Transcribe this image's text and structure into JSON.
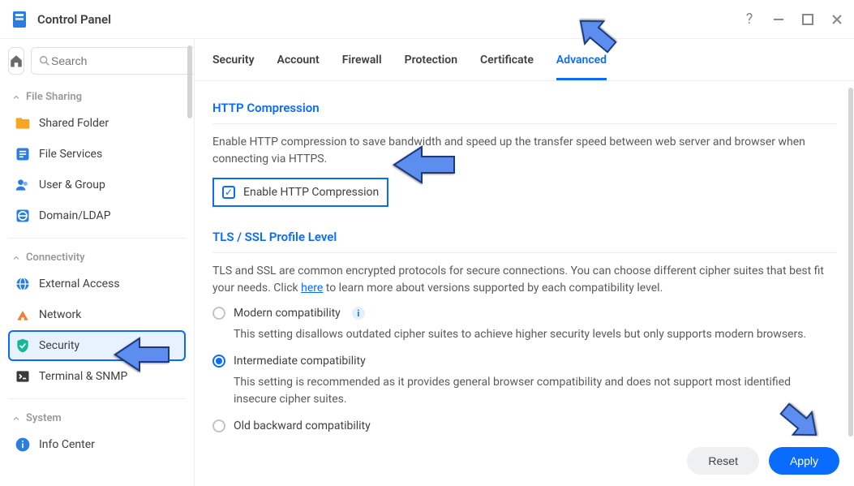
{
  "window": {
    "title": "Control Panel"
  },
  "search": {
    "placeholder": "Search"
  },
  "sidebar": {
    "sections": [
      {
        "label": "File Sharing",
        "items": [
          {
            "label": "Shared Folder",
            "icon": "folder"
          },
          {
            "label": "File Services",
            "icon": "fileservices"
          },
          {
            "label": "User & Group",
            "icon": "usergroup"
          },
          {
            "label": "Domain/LDAP",
            "icon": "domain"
          }
        ]
      },
      {
        "label": "Connectivity",
        "items": [
          {
            "label": "External Access",
            "icon": "globe"
          },
          {
            "label": "Network",
            "icon": "network"
          },
          {
            "label": "Security",
            "icon": "security",
            "active": true
          },
          {
            "label": "Terminal & SNMP",
            "icon": "terminal"
          }
        ]
      },
      {
        "label": "System",
        "items": [
          {
            "label": "Info Center",
            "icon": "info"
          }
        ]
      }
    ]
  },
  "tabs": [
    {
      "label": "Security"
    },
    {
      "label": "Account"
    },
    {
      "label": "Firewall"
    },
    {
      "label": "Protection"
    },
    {
      "label": "Certificate"
    },
    {
      "label": "Advanced",
      "active": true
    }
  ],
  "http_compression": {
    "title": "HTTP Compression",
    "desc": "Enable HTTP compression to save bandwidth and speed up the transfer speed between web server and browser when connecting via HTTPS.",
    "checkbox_label": "Enable HTTP Compression",
    "checked": true
  },
  "tls": {
    "title": "TLS / SSL Profile Level",
    "desc_pre": "TLS and SSL are common encrypted protocols for secure connections. You can choose different cipher suites that best fit your needs. Click ",
    "desc_link": "here",
    "desc_post": " to learn more about versions supported by each compatibility level.",
    "options": [
      {
        "label": "Modern compatibility",
        "desc": "This setting disallows outdated cipher suites to achieve higher security levels but only supports modern browsers.",
        "info": true
      },
      {
        "label": "Intermediate compatibility",
        "desc": "This setting is recommended as it provides general browser compatibility and does not support most identified insecure cipher suites.",
        "checked": true
      },
      {
        "label": "Old backward compatibility"
      }
    ]
  },
  "footer": {
    "reset": "Reset",
    "apply": "Apply"
  }
}
